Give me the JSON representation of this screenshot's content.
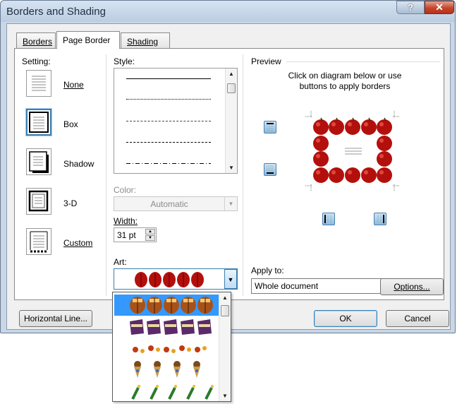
{
  "window": {
    "title": "Borders and Shading",
    "help_glyph": "?",
    "close_glyph": "✕"
  },
  "tabs": [
    {
      "label": "Borders",
      "active": false
    },
    {
      "label": "Page Border",
      "active": true
    },
    {
      "label": "Shading",
      "active": false
    }
  ],
  "setting": {
    "heading": "Setting:",
    "options": [
      {
        "label": "None",
        "selected": false
      },
      {
        "label": "Box",
        "selected": true
      },
      {
        "label": "Shadow",
        "selected": false
      },
      {
        "label": "3-D",
        "selected": false
      },
      {
        "label": "Custom",
        "selected": false
      }
    ]
  },
  "style": {
    "heading": "Style:",
    "lines": [
      "solid",
      "dotted",
      "dashed-fine",
      "dashed",
      "dash-dot"
    ]
  },
  "color": {
    "label": "Color:",
    "value": "Automatic",
    "enabled": false
  },
  "width": {
    "label": "Width:",
    "value": "31 pt"
  },
  "art": {
    "label": "Art:",
    "options": [
      "red-apples",
      "tulips-orange",
      "purple-cakes",
      "flowers-small",
      "ice-cream-cones",
      "green-pencils"
    ],
    "selected": "red-apples",
    "highlighted": "tulips-orange"
  },
  "preview": {
    "heading": "Preview",
    "instruction": "Click on diagram below or use buttons to apply borders"
  },
  "apply_to": {
    "label": "Apply to:",
    "value": "Whole document"
  },
  "buttons": {
    "options": "Options...",
    "horizontal_line": "Horizontal Line...",
    "ok": "OK",
    "cancel": "Cancel"
  },
  "colors": {
    "apple": "#b3100d",
    "highlight": "#3399ff",
    "accent": "#3c7fb1"
  }
}
